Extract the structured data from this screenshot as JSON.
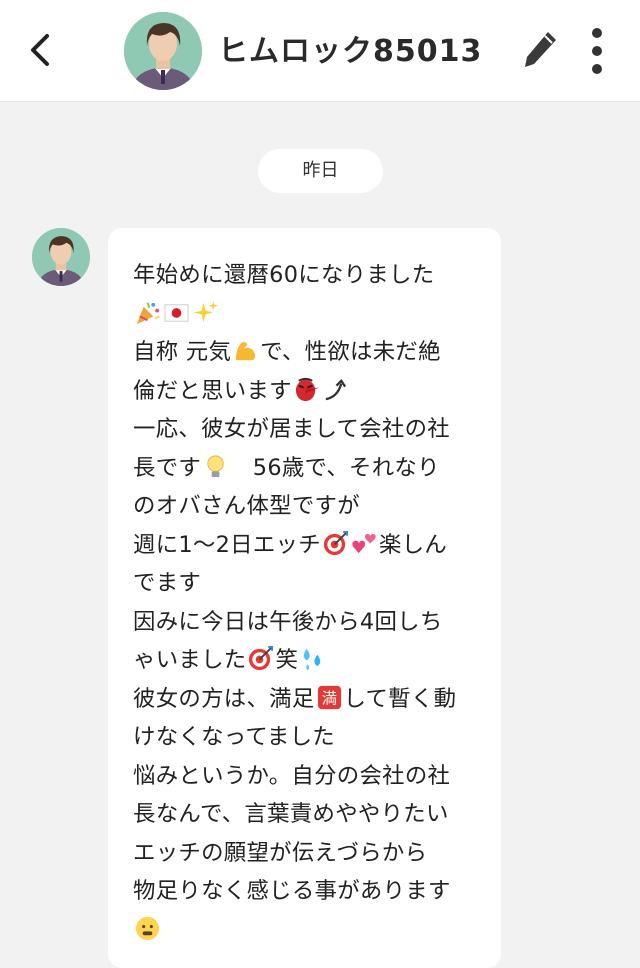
{
  "header": {
    "back_icon": "chevron-left-icon",
    "title": "ヒムロック85013",
    "edit_icon": "pencil-icon",
    "more_icon": "more-vertical-icon"
  },
  "date_separator": "昨日",
  "message": {
    "lines": [
      [
        "年始めに還暦60になりました"
      ],
      [
        "",
        {
          "icon": "party-popper-emoji"
        },
        {
          "icon": "japan-flag-emoji"
        },
        {
          "icon": "sparkles-emoji"
        }
      ],
      [
        "自称 元気",
        {
          "icon": "flexed-biceps-emoji"
        },
        "で、性欲は未だ絶"
      ],
      [
        "倫だと思います",
        {
          "icon": "tengu-mask-emoji"
        },
        {
          "icon": "arrow-up-right-emoji"
        }
      ],
      [
        "一応、彼女が居まして会社の社"
      ],
      [
        "長です",
        {
          "icon": "light-bulb-emoji"
        },
        "　56歳で、それなり"
      ],
      [
        "のオバさん体型ですが"
      ],
      [
        "週に1〜2日エッチ",
        {
          "icon": "direct-hit-emoji"
        },
        {
          "icon": "two-hearts-emoji"
        },
        "楽しん"
      ],
      [
        "でます"
      ],
      [
        "因みに今日は午後から4回しち"
      ],
      [
        "ゃいました",
        {
          "icon": "direct-hit-emoji"
        },
        "笑",
        {
          "icon": "sweat-droplets-emoji"
        }
      ],
      [
        "彼女の方は、満足",
        {
          "icon": "full-sign-emoji"
        },
        "して暫く動"
      ],
      [
        "けなくなってました"
      ],
      [
        "悩みというか。自分の会社の社"
      ],
      [
        "長なんで、言葉責めややりたい"
      ],
      [
        "エッチの願望が伝えづらから"
      ],
      [
        "物足りなく感じる事があります"
      ],
      [
        "",
        {
          "icon": "hushed-face-emoji"
        }
      ]
    ]
  },
  "colors": {
    "page_bg": "#f2f2f2",
    "header_bg": "#ffffff",
    "bubble_bg": "#ffffff",
    "avatar_bg": "#8fc9b4",
    "text": "#222222"
  }
}
